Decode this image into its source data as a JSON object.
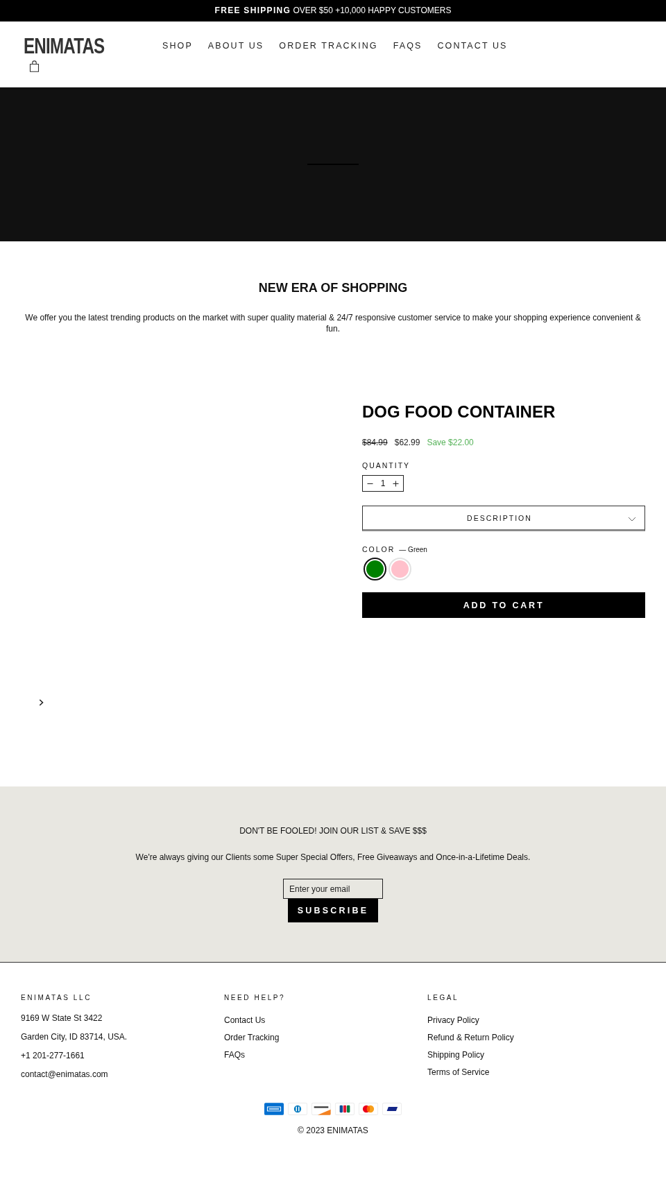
{
  "announcement": {
    "text": "**FREE SHIPPING** OVER $50 +10,000 HAPPY CUSTOMERS"
  },
  "header": {
    "logo": "ENIMATAS",
    "nav": [
      "SHOP",
      "ABOUT US",
      "ORDER TRACKING",
      "FAQS",
      "CONTACT US"
    ]
  },
  "intro": {
    "title": "NEW ERA OF SHOPPING",
    "text": "We offer you the latest trending products on the market with super quality material & 24/7 responsive customer service to make your shopping experience convenient & fun."
  },
  "product": {
    "title": "DOG FOOD CONTAINER",
    "compare_price": "$84.99",
    "price": "$62.99",
    "savings": "Save $22.00",
    "quantity_label": "QUANTITY",
    "quantity": "1",
    "description": {
      "label": "DESCRIPTION",
      "expanded": false
    },
    "color_label": "COLOR",
    "color_value": "— Green",
    "swatches": [
      {
        "color": "#008000",
        "selected": true
      },
      {
        "color": "#ffc0cb",
        "selected": false
      }
    ],
    "add_to_cart": "ADD TO CART"
  },
  "newsletter": {
    "title": "DON'T BE FOOLED! JOIN OUR LIST & SAVE $$$",
    "text": "We're always giving our Clients some Super Special Offers, Free Giveaways and Once-in-a-Lifetime Deals.",
    "placeholder": "Enter your email",
    "button": "SUBSCRIBE"
  },
  "footer": {
    "contact": {
      "heading": "ENIMATAS LLC",
      "lines": [
        "9169 W State St 3422",
        "Garden City, ID 83714, USA.",
        "+1 201-277-1661",
        "contact@enimatas.com"
      ]
    },
    "help": {
      "heading": "NEED HELP?",
      "links": [
        "Contact Us",
        "Order Tracking",
        "FAQs"
      ]
    },
    "legal": {
      "heading": "LEGAL",
      "links": [
        "Privacy Policy",
        "Refund & Return Policy",
        "Shipping Policy",
        "Terms of Service"
      ]
    },
    "payment_icons": [
      {
        "kind": "amex"
      },
      {
        "kind": "diners"
      },
      {
        "kind": "discover"
      },
      {
        "kind": "jcb"
      },
      {
        "kind": "mastercard"
      },
      {
        "kind": "visa"
      }
    ],
    "copyright": "© 2023 ENIMATAS"
  }
}
